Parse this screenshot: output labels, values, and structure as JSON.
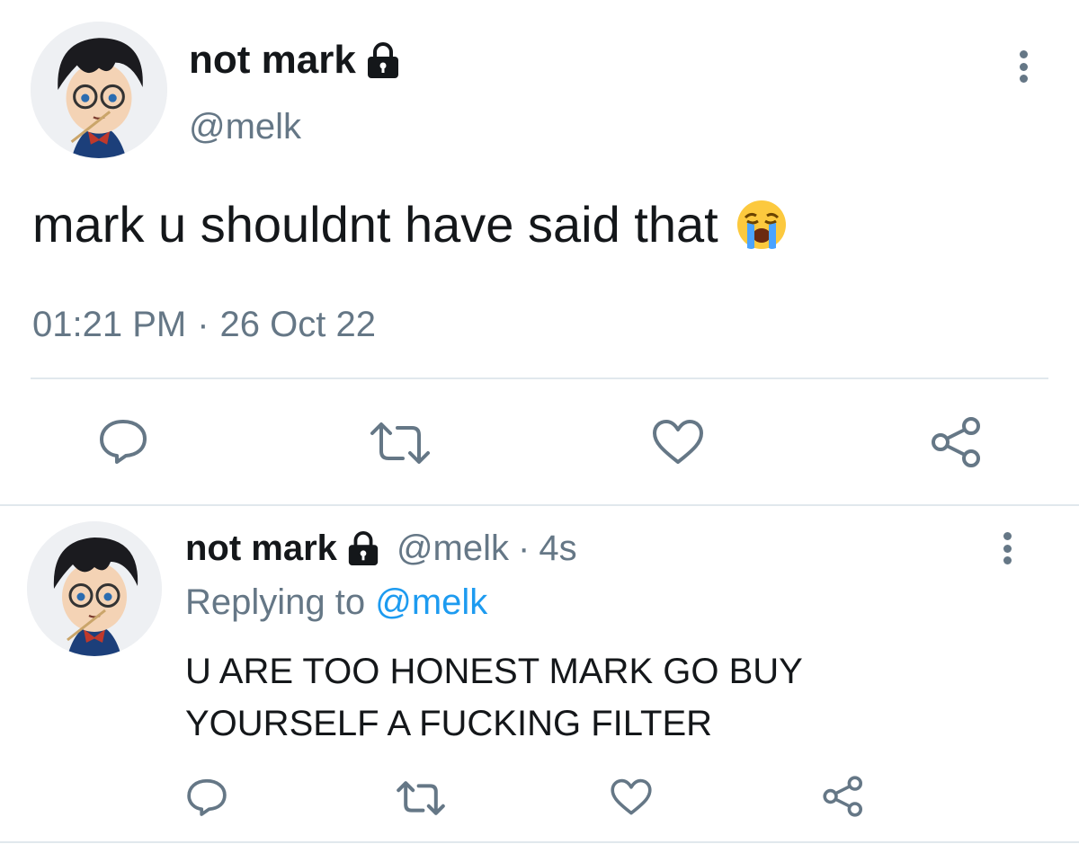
{
  "main_tweet": {
    "display_name": "not mark",
    "handle": "@melk",
    "text": "mark u shouldnt have said that",
    "emoji": "😭",
    "time": "01:21 PM",
    "separator": "·",
    "date": "26 Oct 22",
    "icons": [
      "lock-icon",
      "more-icon",
      "reply-icon",
      "retweet-icon",
      "like-icon",
      "share-icon"
    ]
  },
  "reply_tweet": {
    "display_name": "not mark",
    "handle": "@melk",
    "separator": "·",
    "age": "4s",
    "replying_prefix": "Replying to",
    "replying_handle": "@melk",
    "text_line1": "U ARE TOO HONEST MARK GO BUY",
    "text_line2": "YOURSELF A FUCKING FILTER",
    "icons": [
      "lock-icon",
      "more-icon",
      "reply-icon",
      "retweet-icon",
      "like-icon",
      "share-icon"
    ]
  },
  "colors": {
    "text": "#14171a",
    "muted": "#657786",
    "link": "#1d9bf0",
    "divider": "#e1e8ed",
    "background": "#ffffff"
  }
}
